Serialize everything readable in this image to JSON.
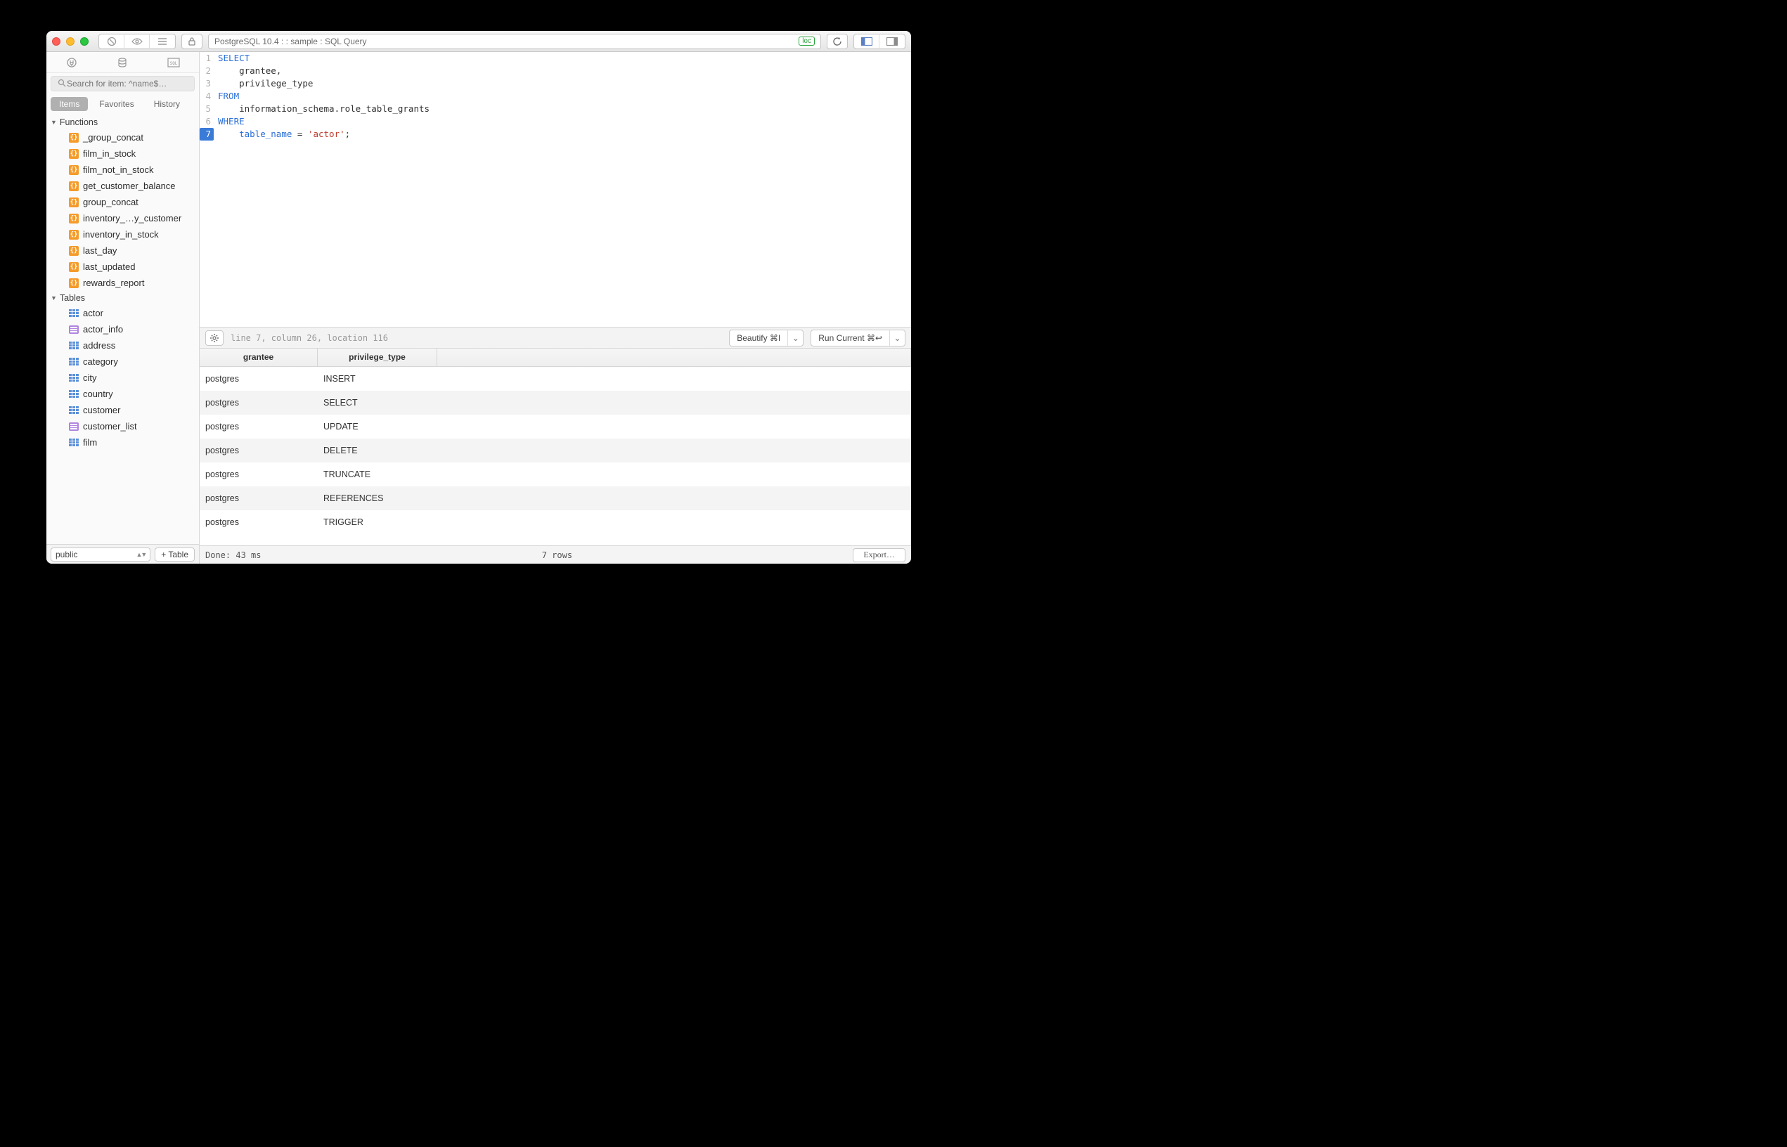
{
  "titlebar": {
    "title": "PostgreSQL 10.4 :  : sample : SQL Query",
    "badge": "loc"
  },
  "sidebar": {
    "search_placeholder": "Search for item: ^name$…",
    "tabs": {
      "items": "Items",
      "favorites": "Favorites",
      "history": "History"
    },
    "functions_label": "Functions",
    "functions": [
      {
        "name": "_group_concat"
      },
      {
        "name": "film_in_stock"
      },
      {
        "name": "film_not_in_stock"
      },
      {
        "name": "get_customer_balance"
      },
      {
        "name": "group_concat"
      },
      {
        "name": "inventory_…y_customer"
      },
      {
        "name": "inventory_in_stock"
      },
      {
        "name": "last_day"
      },
      {
        "name": "last_updated"
      },
      {
        "name": "rewards_report"
      }
    ],
    "tables_label": "Tables",
    "tables": [
      {
        "name": "actor",
        "kind": "table"
      },
      {
        "name": "actor_info",
        "kind": "view"
      },
      {
        "name": "address",
        "kind": "table"
      },
      {
        "name": "category",
        "kind": "table"
      },
      {
        "name": "city",
        "kind": "table"
      },
      {
        "name": "country",
        "kind": "table"
      },
      {
        "name": "customer",
        "kind": "table"
      },
      {
        "name": "customer_list",
        "kind": "view"
      },
      {
        "name": "film",
        "kind": "table"
      }
    ],
    "schema": "public",
    "add_table": "Table"
  },
  "editor": {
    "lines": [
      {
        "n": "1",
        "html": "<span class='kw'>SELECT</span>"
      },
      {
        "n": "2",
        "html": "    grantee,"
      },
      {
        "n": "3",
        "html": "    privilege_type"
      },
      {
        "n": "4",
        "html": "<span class='kw'>FROM</span>"
      },
      {
        "n": "5",
        "html": "    information_schema.role_table_grants"
      },
      {
        "n": "6",
        "html": "<span class='kw'>WHERE</span>"
      },
      {
        "n": "7",
        "html": "    <span class='col'>table_name</span> = <span class='str'>'actor'</span>;",
        "active": true
      }
    ]
  },
  "midbar": {
    "cursor": "line 7, column 26, location 116",
    "beautify": "Beautify ⌘I",
    "run": "Run Current ⌘↩"
  },
  "results": {
    "columns": [
      "grantee",
      "privilege_type"
    ],
    "rows": [
      [
        "postgres",
        "INSERT"
      ],
      [
        "postgres",
        "SELECT"
      ],
      [
        "postgres",
        "UPDATE"
      ],
      [
        "postgres",
        "DELETE"
      ],
      [
        "postgres",
        "TRUNCATE"
      ],
      [
        "postgres",
        "REFERENCES"
      ],
      [
        "postgres",
        "TRIGGER"
      ]
    ]
  },
  "status": {
    "done": "Done: 43 ms",
    "rows": "7 rows",
    "export": "Export…"
  }
}
